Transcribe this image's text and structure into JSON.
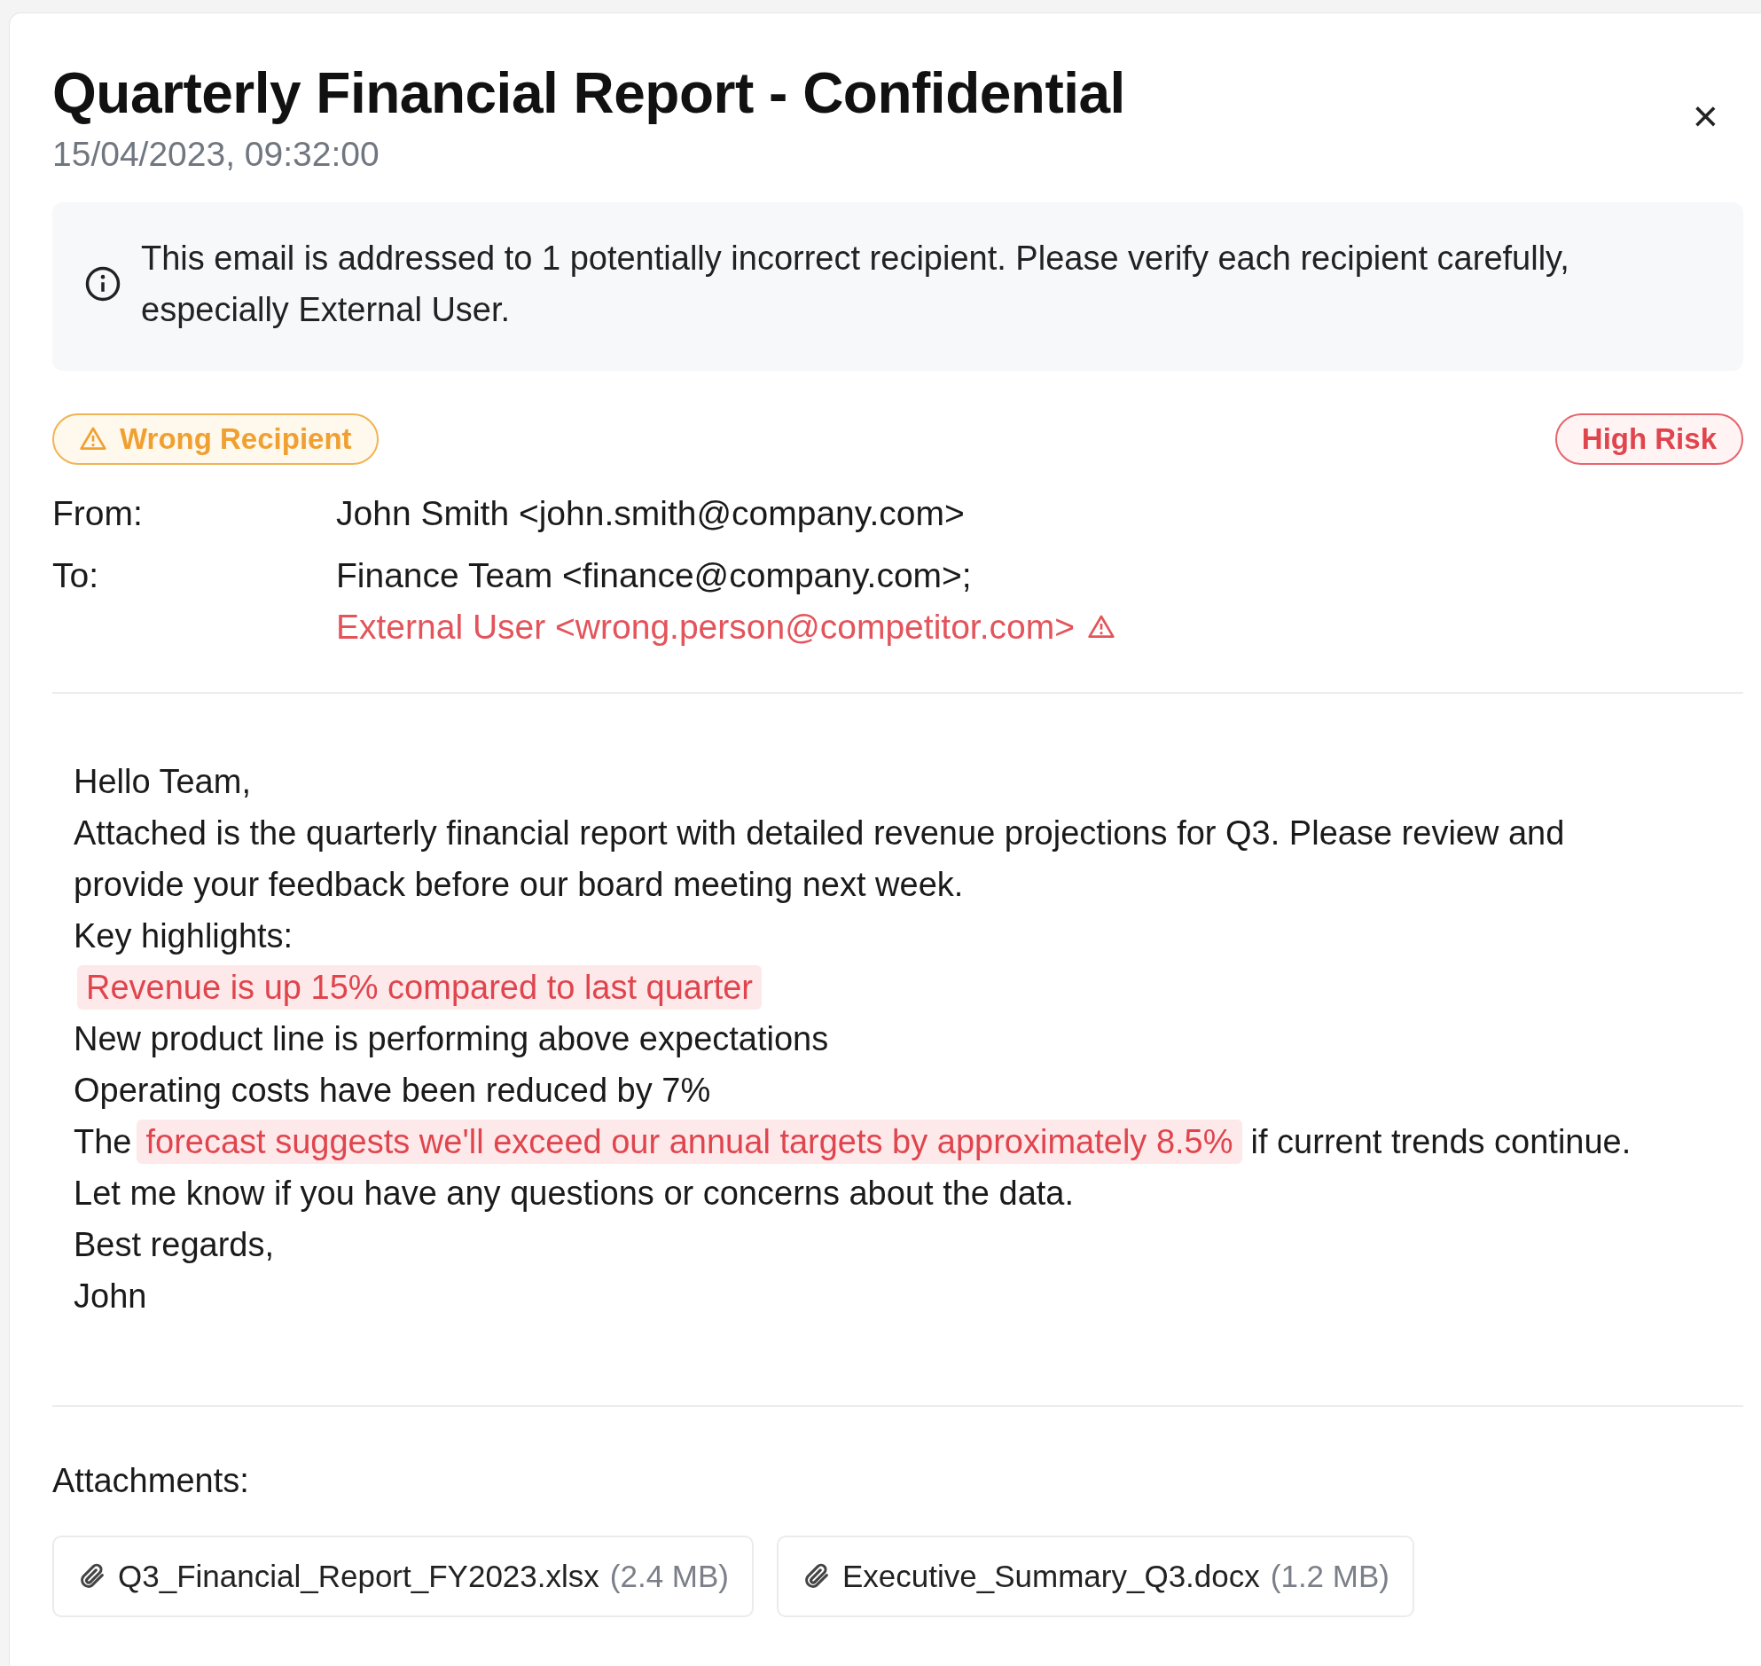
{
  "email": {
    "title": "Quarterly Financial Report - Confidential",
    "timestamp": "15/04/2023, 09:32:00",
    "close": "×"
  },
  "alert": {
    "text": "This email is addressed to 1 potentially incorrect recipient. Please verify each recipient carefully, especially External User."
  },
  "badges": [
    {
      "label": "Wrong Recipient",
      "kind": "warning"
    },
    {
      "label": "High Risk",
      "kind": "risk"
    }
  ],
  "header_fields": [
    {
      "label": "From:",
      "values": [
        {
          "text": "John Smith <john.smith@company.com>",
          "flagged": false
        }
      ]
    },
    {
      "label": "To:",
      "values": [
        {
          "text": "Finance Team <finance@company.com>;",
          "flagged": false
        },
        {
          "text": "External User <wrong.person@competitor.com>",
          "flagged": true
        }
      ]
    }
  ],
  "body": [
    [
      {
        "text": "Hello Team,",
        "highlighted": false
      }
    ],
    [
      {
        "text": "Attached is the quarterly financial report with detailed revenue projections for Q3. Please review and provide your feedback before our board meeting next week.",
        "highlighted": false
      }
    ],
    [
      {
        "text": "Key highlights:",
        "highlighted": false
      }
    ],
    [
      {
        "text": "Revenue is up 15% compared to last quarter",
        "highlighted": true
      }
    ],
    [
      {
        "text": "New product line is performing above expectations",
        "highlighted": false
      }
    ],
    [
      {
        "text": "Operating costs have been reduced by 7%",
        "highlighted": false
      }
    ],
    [
      {
        "text": "The",
        "highlighted": false
      },
      {
        "text": "forecast suggests we'll exceed our annual targets by approximately 8.5%",
        "highlighted": true
      },
      {
        "text": "if current trends continue.",
        "highlighted": false
      }
    ],
    [
      {
        "text": "Let me know if you have any questions or concerns about the data.",
        "highlighted": false
      }
    ],
    [
      {
        "text": "Best regards,",
        "highlighted": false
      }
    ],
    [
      {
        "text": "John",
        "highlighted": false
      }
    ]
  ],
  "attachments": {
    "label": "Attachments:",
    "files": [
      {
        "name": "Q3_Financial_Report_FY2023.xlsx",
        "size": "(2.4 MB)"
      },
      {
        "name": "Executive_Summary_Q3.docx",
        "size": "(1.2 MB)"
      }
    ]
  }
}
